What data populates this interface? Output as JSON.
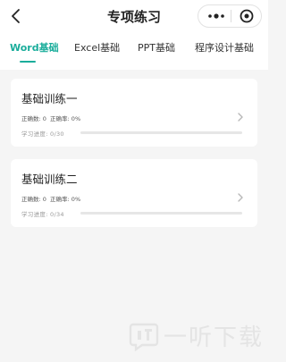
{
  "header": {
    "title": "专项练习",
    "back_icon": "back-arrow-icon",
    "more_icon": "more-dots-icon",
    "close_icon": "target-circle-icon"
  },
  "tabs": [
    {
      "label": "Word基础",
      "active": true
    },
    {
      "label": "Excel基础",
      "active": false
    },
    {
      "label": "PPT基础",
      "active": false
    },
    {
      "label": "程序设计基础",
      "active": false
    }
  ],
  "cards": [
    {
      "title": "基础训练一",
      "correct_label": "正确数: 0",
      "rate_label": "正确率: 0%",
      "progress_label": "学习进度: 0/30",
      "progress": 0
    },
    {
      "title": "基础训练二",
      "correct_label": "正确数: 0",
      "rate_label": "正确率: 0%",
      "progress_label": "学习进度: 0/34",
      "progress": 0
    }
  ],
  "watermark": {
    "text": "一听下载",
    "icon": "yiting-logo-icon"
  },
  "colors": {
    "accent": "#1aad9b",
    "background": "#f5f5f5",
    "card": "#ffffff"
  }
}
